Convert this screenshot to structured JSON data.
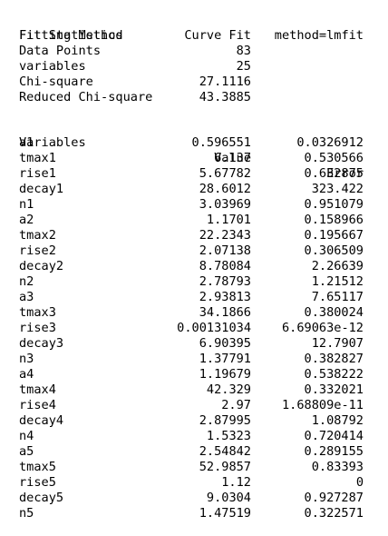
{
  "stats": {
    "title": "Fit Statistics",
    "rows": [
      {
        "label": "Fitting Method",
        "value": "Curve Fit",
        "extra": "method=lmfit"
      },
      {
        "label": "Data Points",
        "value": "83",
        "extra": ""
      },
      {
        "label": "variables",
        "value": "25",
        "extra": ""
      },
      {
        "label": "Chi-square",
        "value": "27.1116",
        "extra": ""
      },
      {
        "label": "Reduced Chi-square",
        "value": "43.3885",
        "extra": ""
      }
    ]
  },
  "variables": {
    "headers": {
      "name": "Variables",
      "value": "Value",
      "error": "Error"
    },
    "rows": [
      {
        "name": "a1",
        "value": "0.596551",
        "error": "0.0326912"
      },
      {
        "name": "tmax1",
        "value": "6.137",
        "error": "0.530566"
      },
      {
        "name": "rise1",
        "value": "5.67782",
        "error": "0.632875"
      },
      {
        "name": "decay1",
        "value": "28.6012",
        "error": "323.422"
      },
      {
        "name": "n1",
        "value": "3.03969",
        "error": "0.951079"
      },
      {
        "name": "a2",
        "value": "1.1701",
        "error": "0.158966"
      },
      {
        "name": "tmax2",
        "value": "22.2343",
        "error": "0.195667"
      },
      {
        "name": "rise2",
        "value": "2.07138",
        "error": "0.306509"
      },
      {
        "name": "decay2",
        "value": "8.78084",
        "error": "2.26639"
      },
      {
        "name": "n2",
        "value": "2.78793",
        "error": "1.21512"
      },
      {
        "name": "a3",
        "value": "2.93813",
        "error": "7.65117"
      },
      {
        "name": "tmax3",
        "value": "34.1866",
        "error": "0.380024"
      },
      {
        "name": "rise3",
        "value": "0.00131034",
        "error": "6.69063e-12"
      },
      {
        "name": "decay3",
        "value": "6.90395",
        "error": "12.7907"
      },
      {
        "name": "n3",
        "value": "1.37791",
        "error": "0.382827"
      },
      {
        "name": "a4",
        "value": "1.19679",
        "error": "0.538222"
      },
      {
        "name": "tmax4",
        "value": "42.329",
        "error": "0.332021"
      },
      {
        "name": "rise4",
        "value": "2.97",
        "error": "1.68809e-11"
      },
      {
        "name": "decay4",
        "value": "2.87995",
        "error": "1.08792"
      },
      {
        "name": "n4",
        "value": "1.5323",
        "error": "0.720414"
      },
      {
        "name": "a5",
        "value": "2.54842",
        "error": "0.289155"
      },
      {
        "name": "tmax5",
        "value": "52.9857",
        "error": "0.83393"
      },
      {
        "name": "rise5",
        "value": "1.12",
        "error": "0"
      },
      {
        "name": "decay5",
        "value": "9.0304",
        "error": "0.927287"
      },
      {
        "name": "n5",
        "value": "1.47519",
        "error": "0.322571"
      }
    ]
  }
}
